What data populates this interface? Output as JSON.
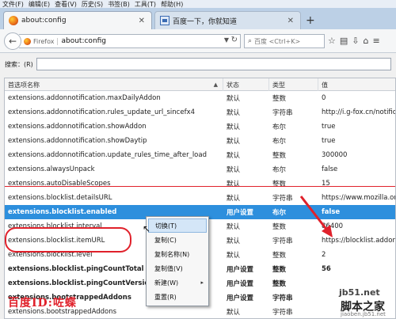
{
  "menubar": {
    "items": [
      "文件(F)",
      "编辑(E)",
      "查看(V)",
      "历史(S)",
      "书签(B)",
      "工具(T)",
      "帮助(H)"
    ]
  },
  "tabs": [
    {
      "label": "about:config",
      "active": true
    },
    {
      "label": "百度一下，你就知道",
      "active": false
    }
  ],
  "navbar": {
    "identity": "Firefox",
    "url": "about:config",
    "search_placeholder": "百度 <Ctrl+K>"
  },
  "filter": {
    "label": "搜索：(R)",
    "value": ""
  },
  "table": {
    "headers": {
      "name": "首选项名称",
      "status": "状态",
      "type": "类型",
      "value": "值"
    },
    "rows": [
      {
        "name": "extensions.addonnotification.maxDailyAddon",
        "status": "默认",
        "type": "整数",
        "value": "0"
      },
      {
        "name": "extensions.addonnotification.rules_update_url_sincefx4",
        "status": "默认",
        "type": "字符串",
        "value": "http://i.g-fox.cn/notificati"
      },
      {
        "name": "extensions.addonnotification.showAddon",
        "status": "默认",
        "type": "布尔",
        "value": "true"
      },
      {
        "name": "extensions.addonnotification.showDaytip",
        "status": "默认",
        "type": "布尔",
        "value": "true"
      },
      {
        "name": "extensions.addonnotification.update_rules_time_after_load",
        "status": "默认",
        "type": "整数",
        "value": "300000"
      },
      {
        "name": "extensions.alwaysUnpack",
        "status": "默认",
        "type": "布尔",
        "value": "false"
      },
      {
        "name": "extensions.autoDisableScopes",
        "status": "默认",
        "type": "整数",
        "value": "15"
      },
      {
        "name": "extensions.blocklist.detailsURL",
        "status": "默认",
        "type": "字符串",
        "value": "https://www.mozilla.org/"
      },
      {
        "name": "extensions.blocklist.enabled",
        "status": "用户设置",
        "type": "布尔",
        "value": "false",
        "selected": true
      },
      {
        "name": "extensions.blocklist.interval",
        "status": "默认",
        "type": "整数",
        "value": "86400"
      },
      {
        "name": "extensions.blocklist.itemURL",
        "status": "默认",
        "type": "字符串",
        "value": "https://blocklist.addons.r"
      },
      {
        "name": "extensions.blocklist.level",
        "status": "默认",
        "type": "整数",
        "value": "2"
      },
      {
        "name": "extensions.blocklist.pingCountTotal",
        "status": "用户设置",
        "type": "整数",
        "value": "56",
        "bold": true
      },
      {
        "name": "extensions.blocklist.pingCountVersion",
        "status": "用户设置",
        "type": "整数",
        "value": "",
        "bold": true
      },
      {
        "name": "extensions.bootstrappedAddons",
        "status": "用户设置",
        "type": "字符串",
        "value": "",
        "bold": true
      },
      {
        "name": "extensions.bootstrappedAddons",
        "status": "默认",
        "type": "字符串",
        "value": ""
      }
    ]
  },
  "context_menu": {
    "items": [
      {
        "label": "切换(T)",
        "highlighted": true
      },
      {
        "label": "复制(C)"
      },
      {
        "label": "复制名称(N)"
      },
      {
        "label": "复制值(V)"
      },
      {
        "label": "新建(W)",
        "submenu": true
      },
      {
        "label": "重置(R)"
      }
    ]
  },
  "watermarks": {
    "left": "百度ID:咗蝶",
    "right_site": "jb51.net",
    "right_name": "脚本之家",
    "right_url": "jiaoben.jb51.net"
  },
  "colors": {
    "selection": "#2d8fdd",
    "annotation_red": "#e0212b",
    "tabstrip": "#bcd0e6"
  }
}
